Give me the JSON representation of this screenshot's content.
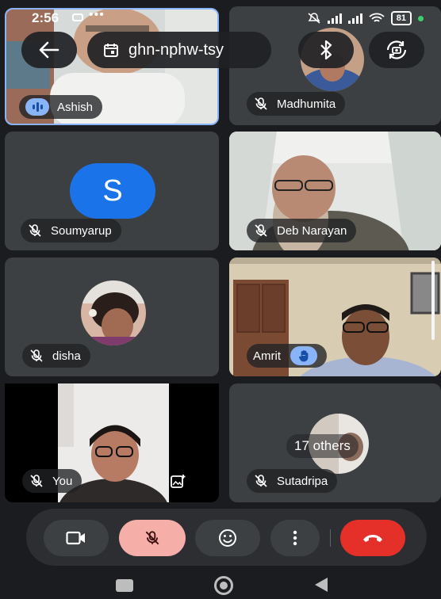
{
  "status_bar": {
    "time": "2:56",
    "notification_dots": "•••",
    "battery": "81"
  },
  "meeting": {
    "code": "ghn-nphw-tsy"
  },
  "participants": [
    {
      "name": "Ashish",
      "avatar_letter": "",
      "state": "speaking"
    },
    {
      "name": "Madhumita",
      "avatar_letter": "",
      "state": "muted"
    },
    {
      "name": "Soumyarup",
      "avatar_letter": "S",
      "state": "muted",
      "avatar_color": "#1a73e8"
    },
    {
      "name": "Deb Narayan",
      "avatar_letter": "",
      "state": "muted"
    },
    {
      "name": "disha",
      "avatar_letter": "",
      "state": "muted"
    },
    {
      "name": "Amrit",
      "avatar_letter": "",
      "state": "hand-raised"
    },
    {
      "name": "You",
      "avatar_letter": "",
      "state": "muted"
    },
    {
      "name": "Sutadripa",
      "avatar_letter": "",
      "state": "muted"
    }
  ],
  "others": {
    "label": "17 others"
  },
  "controls": [
    {
      "id": "camera",
      "icon": "video-camera-icon"
    },
    {
      "id": "mic",
      "icon": "mic-off-icon",
      "state": "off",
      "color": "#f6aea9"
    },
    {
      "id": "reactions",
      "icon": "emoji-icon"
    },
    {
      "id": "more",
      "icon": "more-vertical-icon"
    },
    {
      "id": "leave",
      "icon": "hang-up-icon",
      "color": "#e5302a"
    }
  ],
  "colors": {
    "accent_blue": "#8ab4f8",
    "tile_bg": "#3c4043",
    "screen_bg": "#1b1c1f"
  }
}
